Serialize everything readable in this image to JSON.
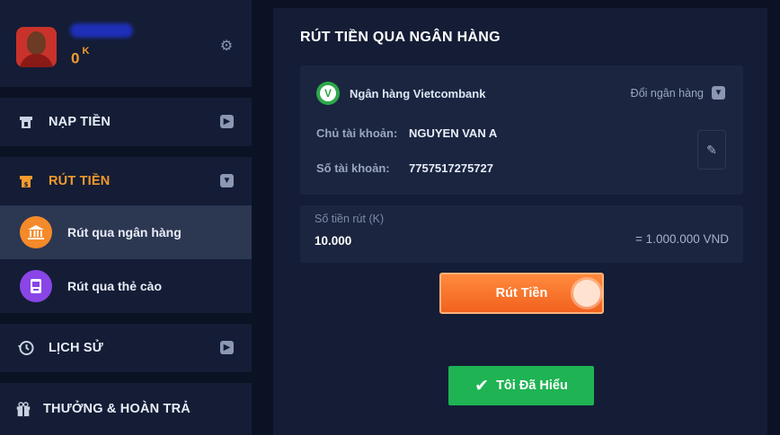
{
  "profile": {
    "username": "username",
    "balance": "0",
    "balance_unit": "K"
  },
  "sidebar": {
    "deposit": "NẠP TIỀN",
    "withdraw": "RÚT TIỀN",
    "sub_items": [
      {
        "label": "Rút qua ngân hàng"
      },
      {
        "label": "Rút qua thẻ cào"
      }
    ],
    "history": "LỊCH SỬ",
    "rewards": "THƯỞNG & HOÀN TRẢ"
  },
  "main": {
    "title": "RÚT TIỀN QUA NGÂN HÀNG",
    "bank": {
      "name": "Ngân hàng Vietcombank",
      "change_label": "Đổi ngân hàng",
      "holder_label": "Chủ tài khoản:",
      "holder_value": "NGUYEN VAN A",
      "account_label": "Số tài khoản:",
      "account_value": "7757517275727"
    },
    "amount": {
      "label": "Số tiền rút (K)",
      "value": "10.000",
      "converted": "= 1.000.000 VND"
    },
    "withdraw_button": "Rút Tiền",
    "ok_button": "Tôi Đã Hiểu"
  },
  "colors": {
    "accent": "#f59a2e",
    "success": "#1fb354",
    "panel": "#141d35"
  }
}
